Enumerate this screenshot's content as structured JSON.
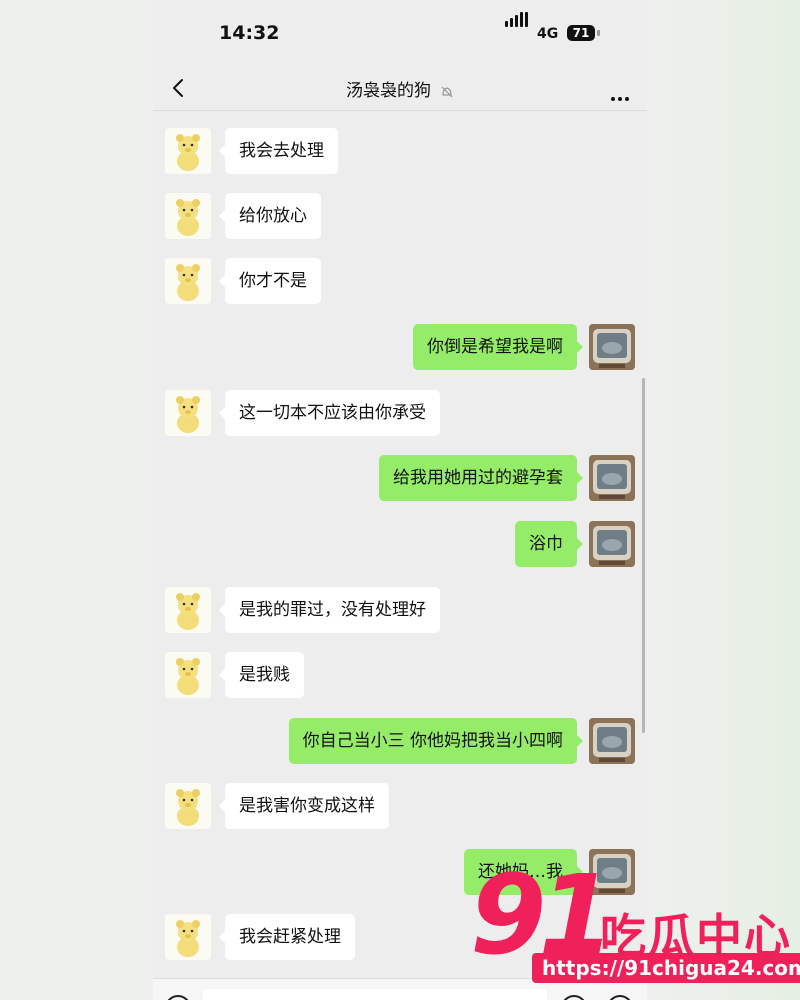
{
  "status_bar": {
    "time": "14:32",
    "network": "4G",
    "battery": "71"
  },
  "nav": {
    "title": "汤袅袅的狗"
  },
  "messages": [
    {
      "side": "left",
      "text": "我会去处理"
    },
    {
      "side": "left",
      "text": "给你放心"
    },
    {
      "side": "left",
      "text": "你才不是"
    },
    {
      "side": "right",
      "text": "你倒是希望我是啊"
    },
    {
      "side": "left",
      "text": "这一切本不应该由你承受"
    },
    {
      "side": "right",
      "text": "给我用她用过的避孕套"
    },
    {
      "side": "right",
      "text": "浴巾"
    },
    {
      "side": "left",
      "text": "是我的罪过，没有处理好"
    },
    {
      "side": "left",
      "text": "是我贱"
    },
    {
      "side": "right",
      "text": "你自己当小三 你他妈把我当小四啊"
    },
    {
      "side": "left",
      "text": "是我害你变成这样"
    },
    {
      "side": "right",
      "text": "还她妈…我"
    },
    {
      "side": "left",
      "text": "我会赶紧处理"
    }
  ],
  "watermark": {
    "number": "91",
    "brand": "吃瓜中心",
    "url": "https://91chigua24.com"
  },
  "colors": {
    "sent_bubble": "#95ec69",
    "received_bubble": "#ffffff",
    "chat_bg": "#ededed",
    "watermark": "#f0205a"
  },
  "icons": {
    "back": "chevron-left-icon",
    "mute": "bell-off-icon",
    "more": "more-dots-icon",
    "left_avatar": "yellow-bear-avatar",
    "right_avatar": "tv-photo-avatar"
  }
}
